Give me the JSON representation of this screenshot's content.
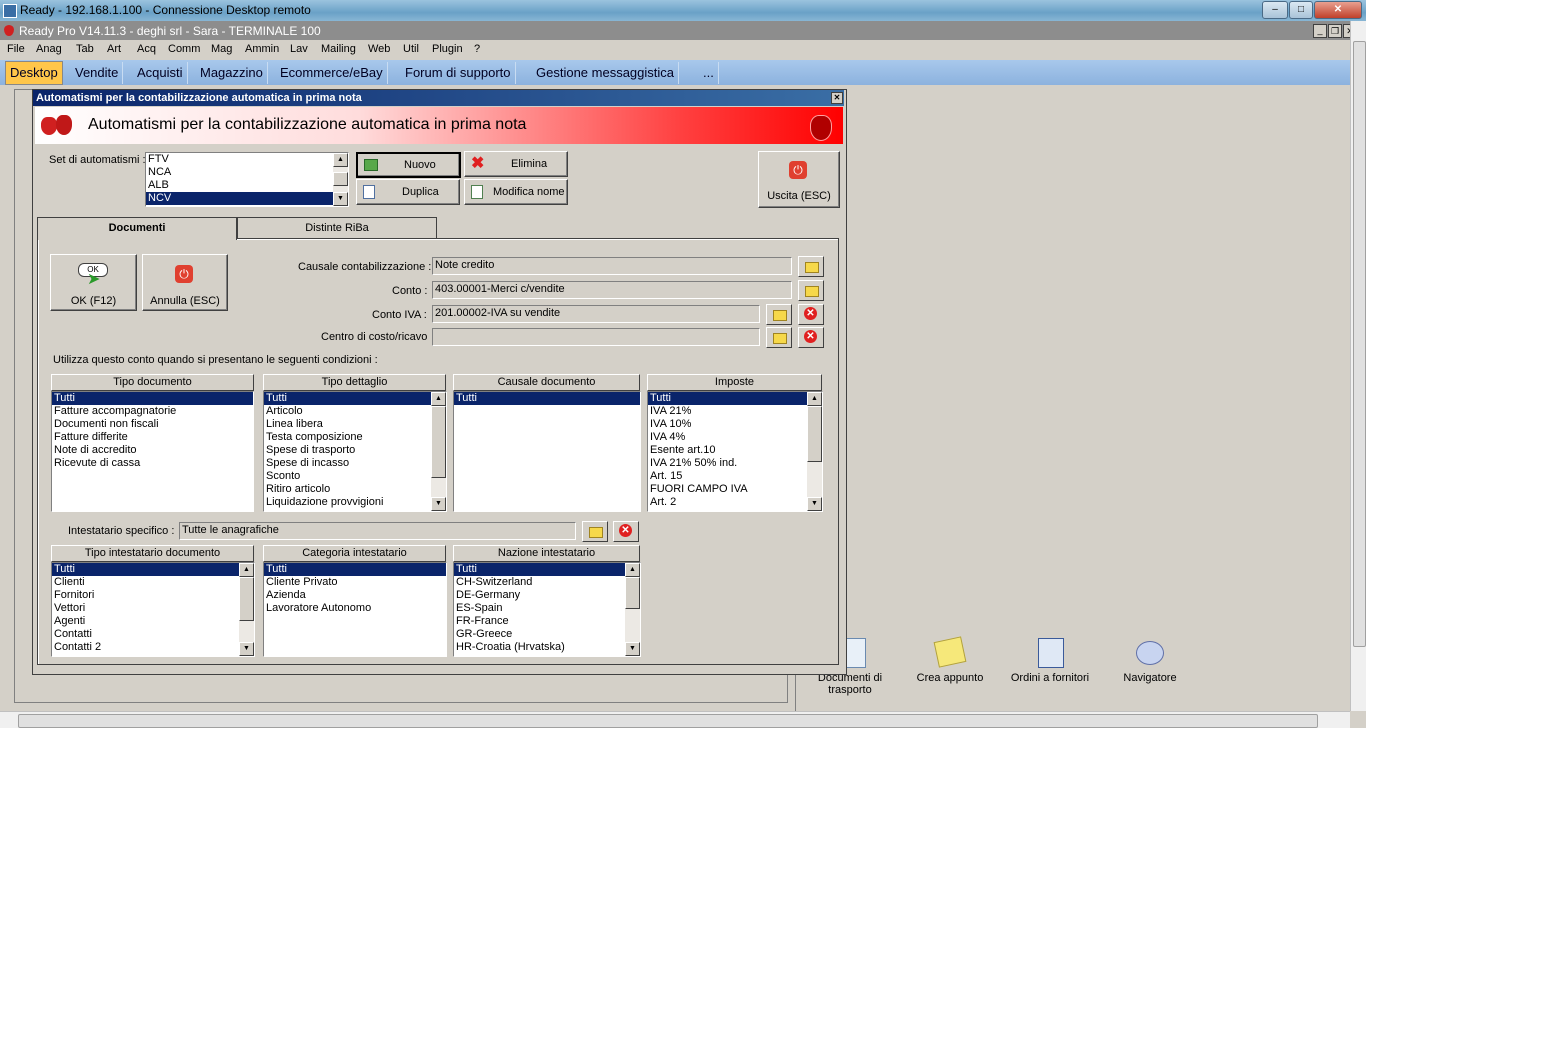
{
  "rdp": {
    "title": "Ready - 192.168.1.100 - Connessione Desktop remoto"
  },
  "app": {
    "title": "Ready Pro V14.11.3 - deghi srl - Sara - TERMINALE 100"
  },
  "menu": [
    "File",
    "Anag",
    "Tab",
    "Art",
    "Acq",
    "Comm",
    "Mag",
    "Ammin",
    "Lav",
    "Mailing",
    "Web",
    "Util",
    "Plugin",
    "?"
  ],
  "tabs": [
    "Desktop",
    "Vendite",
    "Acquisti",
    "Magazzino",
    "Ecommerce/eBay",
    "Forum di supporto",
    "Gestione messaggistica",
    "..."
  ],
  "desktop_icons": [
    "Documenti di trasporto",
    "Crea appunto",
    "Ordini a fornitori",
    "Navigatore"
  ],
  "dialog": {
    "caption": "Automatismi per la contabilizzazione automatica in prima nota",
    "banner": "Automatismi per la contabilizzazione automatica in prima nota",
    "set_label": "Set di automatismi :",
    "sets": [
      "FTV",
      "NCA",
      "ALB",
      "NCV"
    ],
    "buttons": {
      "nuovo": "Nuovo",
      "elimina": "Elimina",
      "duplica": "Duplica",
      "modifica": "Modifica nome",
      "uscita": "Uscita (ESC)",
      "ok": "OK (F12)",
      "annulla": "Annulla (ESC)"
    },
    "tabs": [
      "Documenti",
      "Distinte RiBa"
    ],
    "fields": {
      "causale_label": "Causale contabilizzazione :",
      "causale_value": "Note credito",
      "conto_label": "Conto :",
      "conto_value": "403.00001-Merci c/vendite",
      "conto_iva_label": "Conto IVA :",
      "conto_iva_value": "201.00002-IVA su vendite",
      "centro_label": "Centro di costo/ricavo",
      "centro_value": "",
      "condizioni_label": "Utilizza questo conto quando si presentano le seguenti condizioni :",
      "intestatario_label": "Intestatario specifico :",
      "intestatario_value": "Tutte le anagrafiche"
    },
    "lists": {
      "tipo_documento": {
        "header": "Tipo documento",
        "items": [
          "Tutti",
          "Fatture accompagnatorie",
          "Documenti non fiscali",
          "Fatture differite",
          "Note di accredito",
          "Ricevute di cassa"
        ]
      },
      "tipo_dettaglio": {
        "header": "Tipo dettaglio",
        "items": [
          "Tutti",
          "Articolo",
          "Linea libera",
          "Testa composizione",
          "Spese di trasporto",
          "Spese di incasso",
          "Sconto",
          "Ritiro articolo",
          "Liquidazione provvigioni"
        ]
      },
      "causale_documento": {
        "header": "Causale documento",
        "items": [
          "Tutti"
        ]
      },
      "imposte": {
        "header": "Imposte",
        "items": [
          "Tutti",
          "IVA 21%",
          "IVA 10%",
          "IVA 4%",
          "Esente art.10",
          "IVA 21% 50% ind.",
          "Art. 15",
          "FUORI CAMPO IVA",
          "Art. 2"
        ]
      },
      "tipo_intestatario": {
        "header": "Tipo intestatario documento",
        "items": [
          "Tutti",
          "Clienti",
          "Fornitori",
          "Vettori",
          "Agenti",
          "Contatti",
          "Contatti 2"
        ]
      },
      "categoria_intestatario": {
        "header": "Categoria intestatario",
        "items": [
          "Tutti",
          "Cliente Privato",
          "Azienda",
          "Lavoratore Autonomo"
        ]
      },
      "nazione_intestatario": {
        "header": "Nazione intestatario",
        "items": [
          "Tutti",
          "CH-Switzerland",
          "DE-Germany",
          "ES-Spain",
          "FR-France",
          "GR-Greece",
          "HR-Croatia (Hrvatska)"
        ]
      }
    }
  }
}
